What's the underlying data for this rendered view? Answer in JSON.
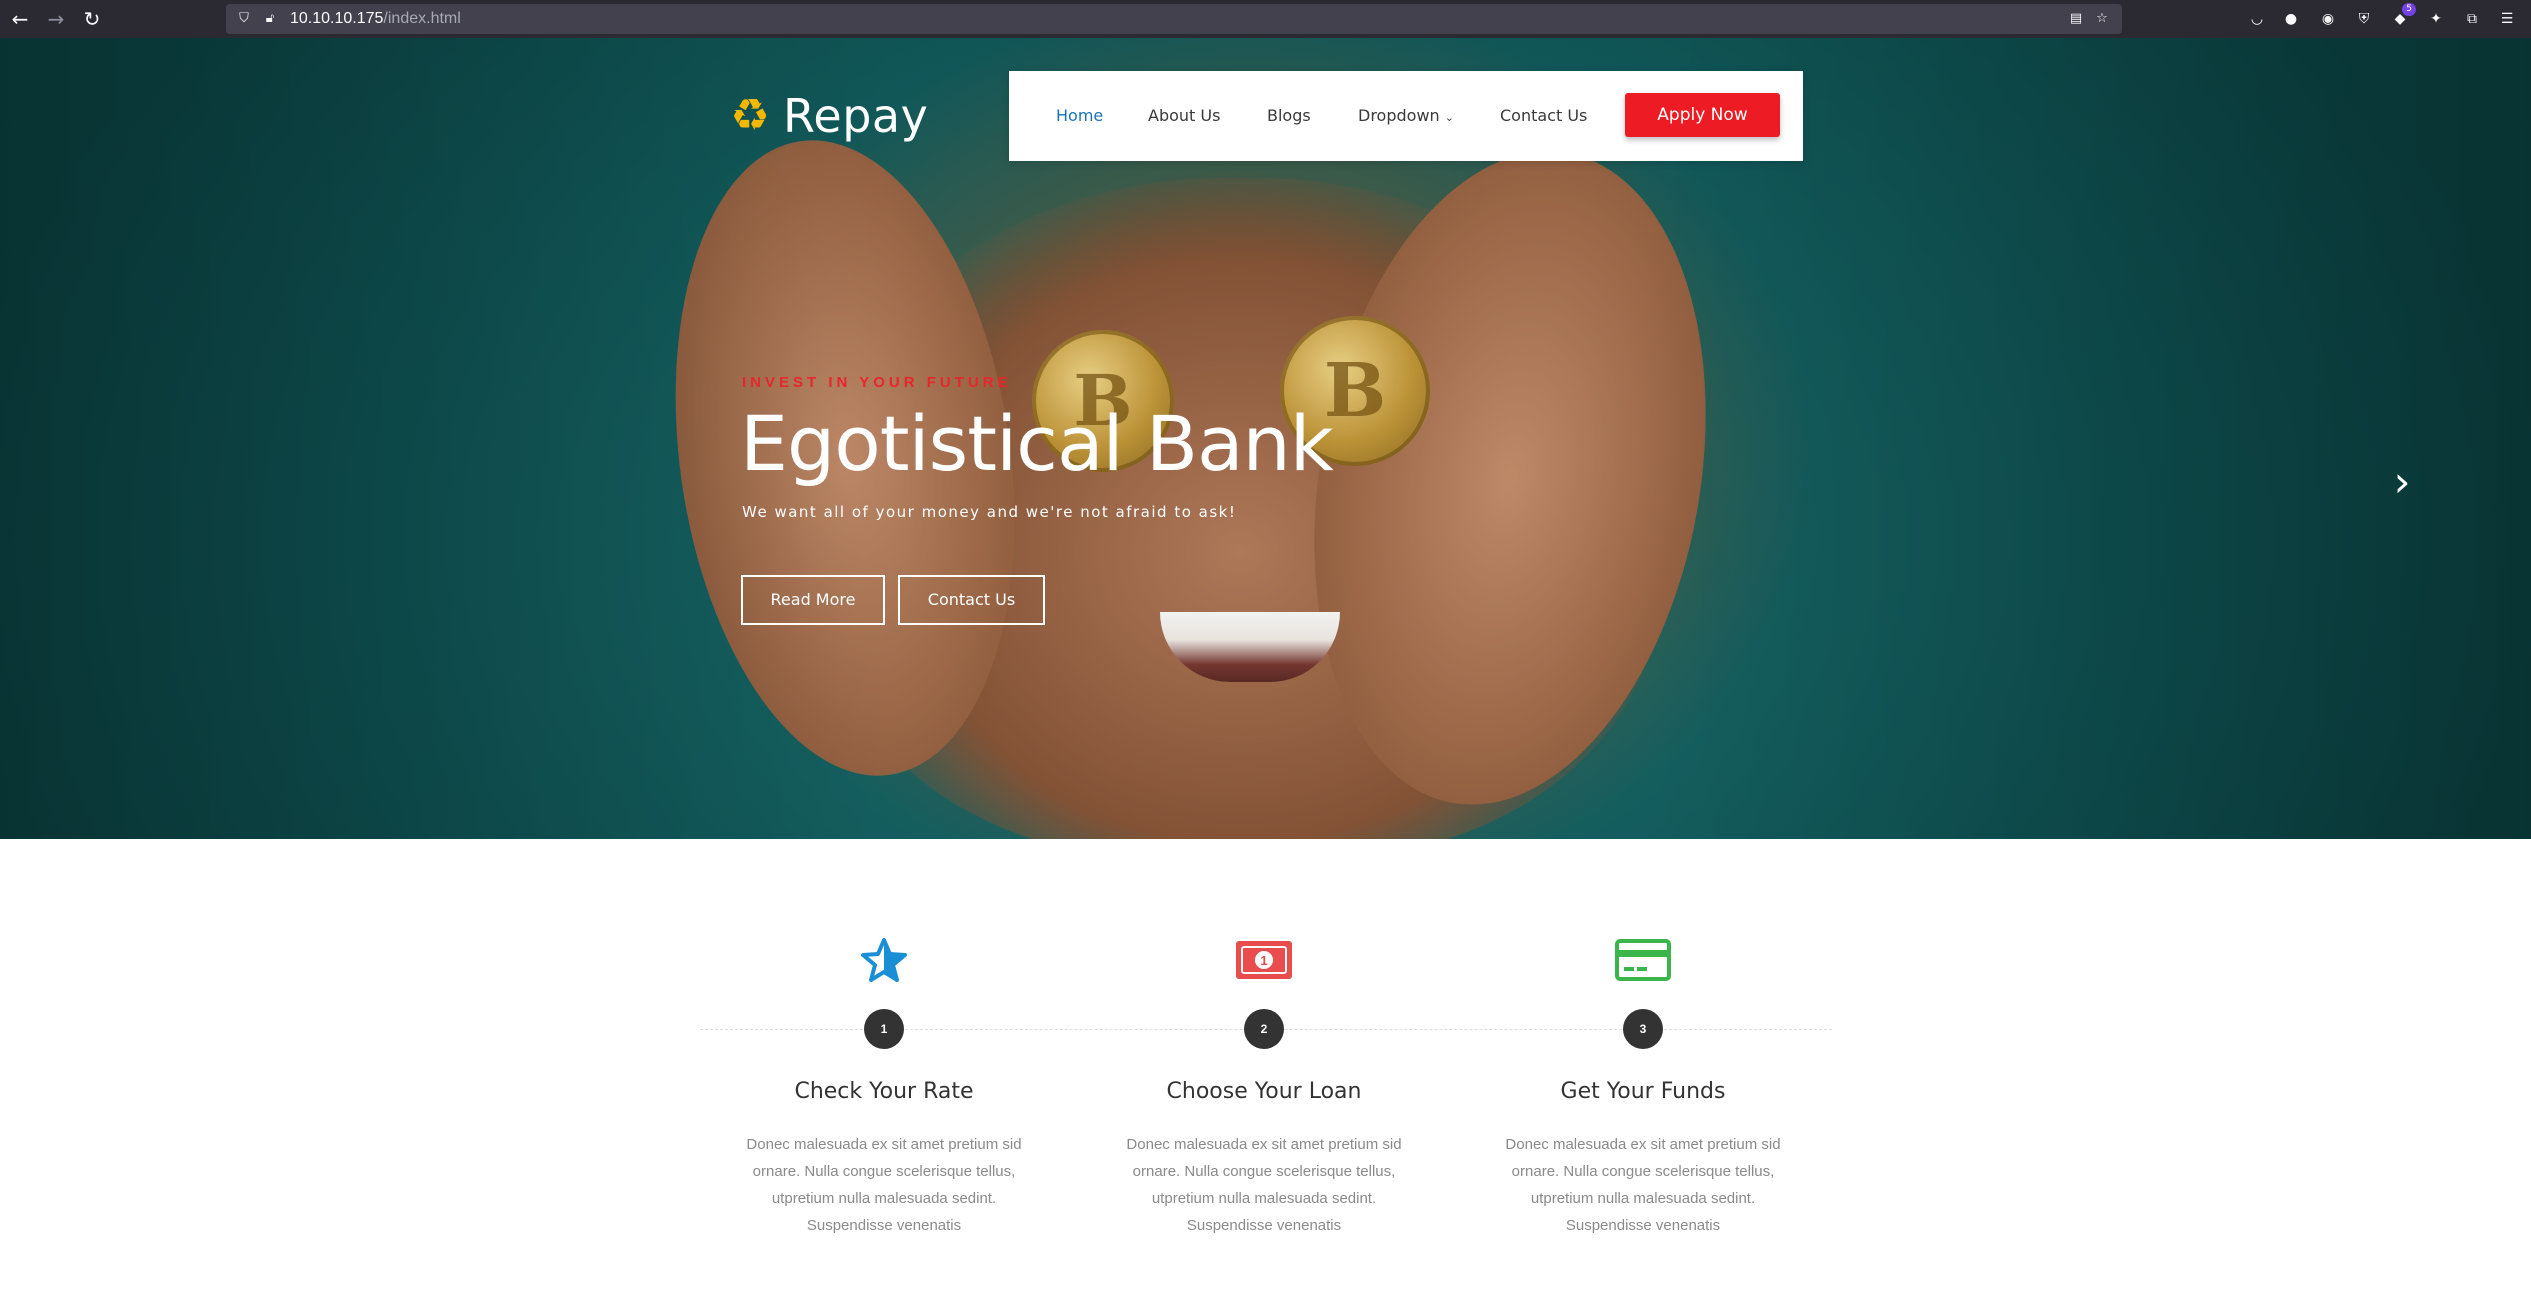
{
  "browser": {
    "url_host": "10.10.10.175",
    "url_path": "/index.html",
    "extension_badge": "5"
  },
  "site": {
    "logo_text": "Repay",
    "nav": [
      "Home",
      "About Us",
      "Blogs",
      "Dropdown",
      "Contact Us"
    ],
    "apply_label": "Apply Now"
  },
  "hero": {
    "eyebrow": "INVEST IN YOUR FUTURE",
    "title": "Egotistical Bank",
    "subtitle": "We want all of your money and we're not afraid to ask!",
    "read_more": "Read More",
    "contact_us": "Contact Us"
  },
  "features": [
    {
      "number": "1",
      "title": "Check Your Rate",
      "desc": "Donec malesuada ex sit amet pretium sid ornare. Nulla congue scelerisque tellus, utpretium nulla malesuada sedint. Suspendisse venenatis",
      "icon": "star-icon",
      "color": "#1a8fd6"
    },
    {
      "number": "2",
      "title": "Choose Your Loan",
      "desc": "Donec malesuada ex sit amet pretium sid ornare. Nulla congue scelerisque tellus, utpretium nulla malesuada sedint. Suspendisse venenatis",
      "icon": "money-bill-icon",
      "color": "#e84c4c"
    },
    {
      "number": "3",
      "title": "Get Your Funds",
      "desc": "Donec malesuada ex sit amet pretium sid ornare. Nulla congue scelerisque tellus, utpretium nulla malesuada sedint. Suspendisse venenatis",
      "icon": "credit-card-icon",
      "color": "#3ab54a"
    }
  ],
  "colors": {
    "accent_red": "#ed1c24",
    "nav_active": "#1a73b8",
    "hero_teal": "#1a6b6c"
  }
}
